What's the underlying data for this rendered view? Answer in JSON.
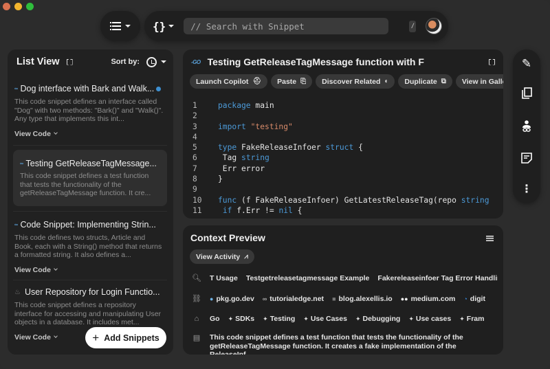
{
  "topbar": {
    "view_menu_icon": "list-icon",
    "language_menu_icon": "braces-icon",
    "search_placeholder": "// Search with Snippet",
    "shortcut_key": "/"
  },
  "list_panel": {
    "title": "List View",
    "sort_label": "Sort by:",
    "items": [
      {
        "language": "Go",
        "title": "Dog interface with Bark and Walk...",
        "description": "This code snippet defines an interface called \"Dog\" with two methods: \"Bark()\" and \"Walk()\". Any type that implements this int...",
        "view_code": "View Code",
        "unread": true,
        "active": false
      },
      {
        "language": "Go",
        "title": "Testing GetReleaseTagMessage...",
        "description": "This code snippet defines a test function that tests the functionality of the getReleaseTagMessage function. It cre...",
        "view_code": "",
        "unread": false,
        "active": true
      },
      {
        "language": "Go",
        "title": "Code Snippet: Implementing Strin...",
        "description": "This code defines two structs, Article and Book, each with a String() method that returns a formatted string. It also defines a...",
        "view_code": "View Code",
        "unread": false,
        "active": false
      },
      {
        "language": "Java",
        "title": "User Repository for Login Functio...",
        "description": "This code snippet defines a repository interface for accessing and manipulating User objects in a database. It includes met...",
        "view_code": "View Code",
        "unread": false,
        "active": false
      }
    ],
    "add_button": "Add Snippets"
  },
  "code_panel": {
    "language": "GO",
    "title": "Testing GetReleaseTagMessage function with F",
    "actions": [
      {
        "label": "Launch Copilot",
        "icon": "copilot-icon"
      },
      {
        "label": "Paste",
        "icon": "paste-icon"
      },
      {
        "label": "Discover Related",
        "icon": "related-icon"
      },
      {
        "label": "Duplicate",
        "icon": "duplicate-icon"
      },
      {
        "label": "View in Gallery",
        "icon": "gallery-icon"
      }
    ],
    "lines": [
      {
        "n": "1",
        "tokens": [
          [
            "kw",
            "package"
          ],
          [
            "id",
            " main"
          ]
        ]
      },
      {
        "n": "2",
        "tokens": []
      },
      {
        "n": "3",
        "tokens": [
          [
            "kw",
            "import"
          ],
          [
            "id",
            " "
          ],
          [
            "str",
            "\"testing\""
          ]
        ]
      },
      {
        "n": "4",
        "tokens": []
      },
      {
        "n": "5",
        "tokens": [
          [
            "kw",
            "type"
          ],
          [
            "id",
            " FakeReleaseInfoer "
          ],
          [
            "kw",
            "struct"
          ],
          [
            "id",
            " {"
          ]
        ]
      },
      {
        "n": "6",
        "tokens": [
          [
            "id",
            " Tag "
          ],
          [
            "kw",
            "string"
          ]
        ]
      },
      {
        "n": "7",
        "tokens": [
          [
            "id",
            " Err error"
          ]
        ]
      },
      {
        "n": "8",
        "tokens": [
          [
            "id",
            "}"
          ]
        ]
      },
      {
        "n": "9",
        "tokens": []
      },
      {
        "n": "10",
        "tokens": [
          [
            "kw",
            "func"
          ],
          [
            "id",
            " (f FakeReleaseInfoer) GetLatestReleaseTag(repo "
          ],
          [
            "kw",
            "string"
          ]
        ]
      },
      {
        "n": "11",
        "tokens": [
          [
            "id",
            " "
          ],
          [
            "kw",
            "if"
          ],
          [
            "id",
            " f.Err != "
          ],
          [
            "kw",
            "nil"
          ],
          [
            "id",
            " {"
          ]
        ]
      }
    ]
  },
  "context_panel": {
    "title": "Context Preview",
    "view_activity": "View Activity",
    "searches": [
      "T Usage",
      "Testgetreleasetagmessage Example",
      "Fakereleaseinfoer Tag Error Handling"
    ],
    "links": [
      "pkg.go.dev",
      "tutorialedge.net",
      "blog.alexellis.io",
      "medium.com",
      "digit"
    ],
    "tags": [
      "Go",
      "SDKs",
      "Testing",
      "Use Cases",
      "Debugging",
      "Use cases",
      "Fram"
    ],
    "description": "This code snippet defines a test function that tests the functionality of the getReleaseTagMessage function. It creates a fake implementation of the ReleaseInf..."
  },
  "right_toolbar": {
    "buttons": [
      "edit-icon",
      "copy-icon",
      "share-person-icon",
      "notes-icon",
      "more-icon"
    ]
  }
}
